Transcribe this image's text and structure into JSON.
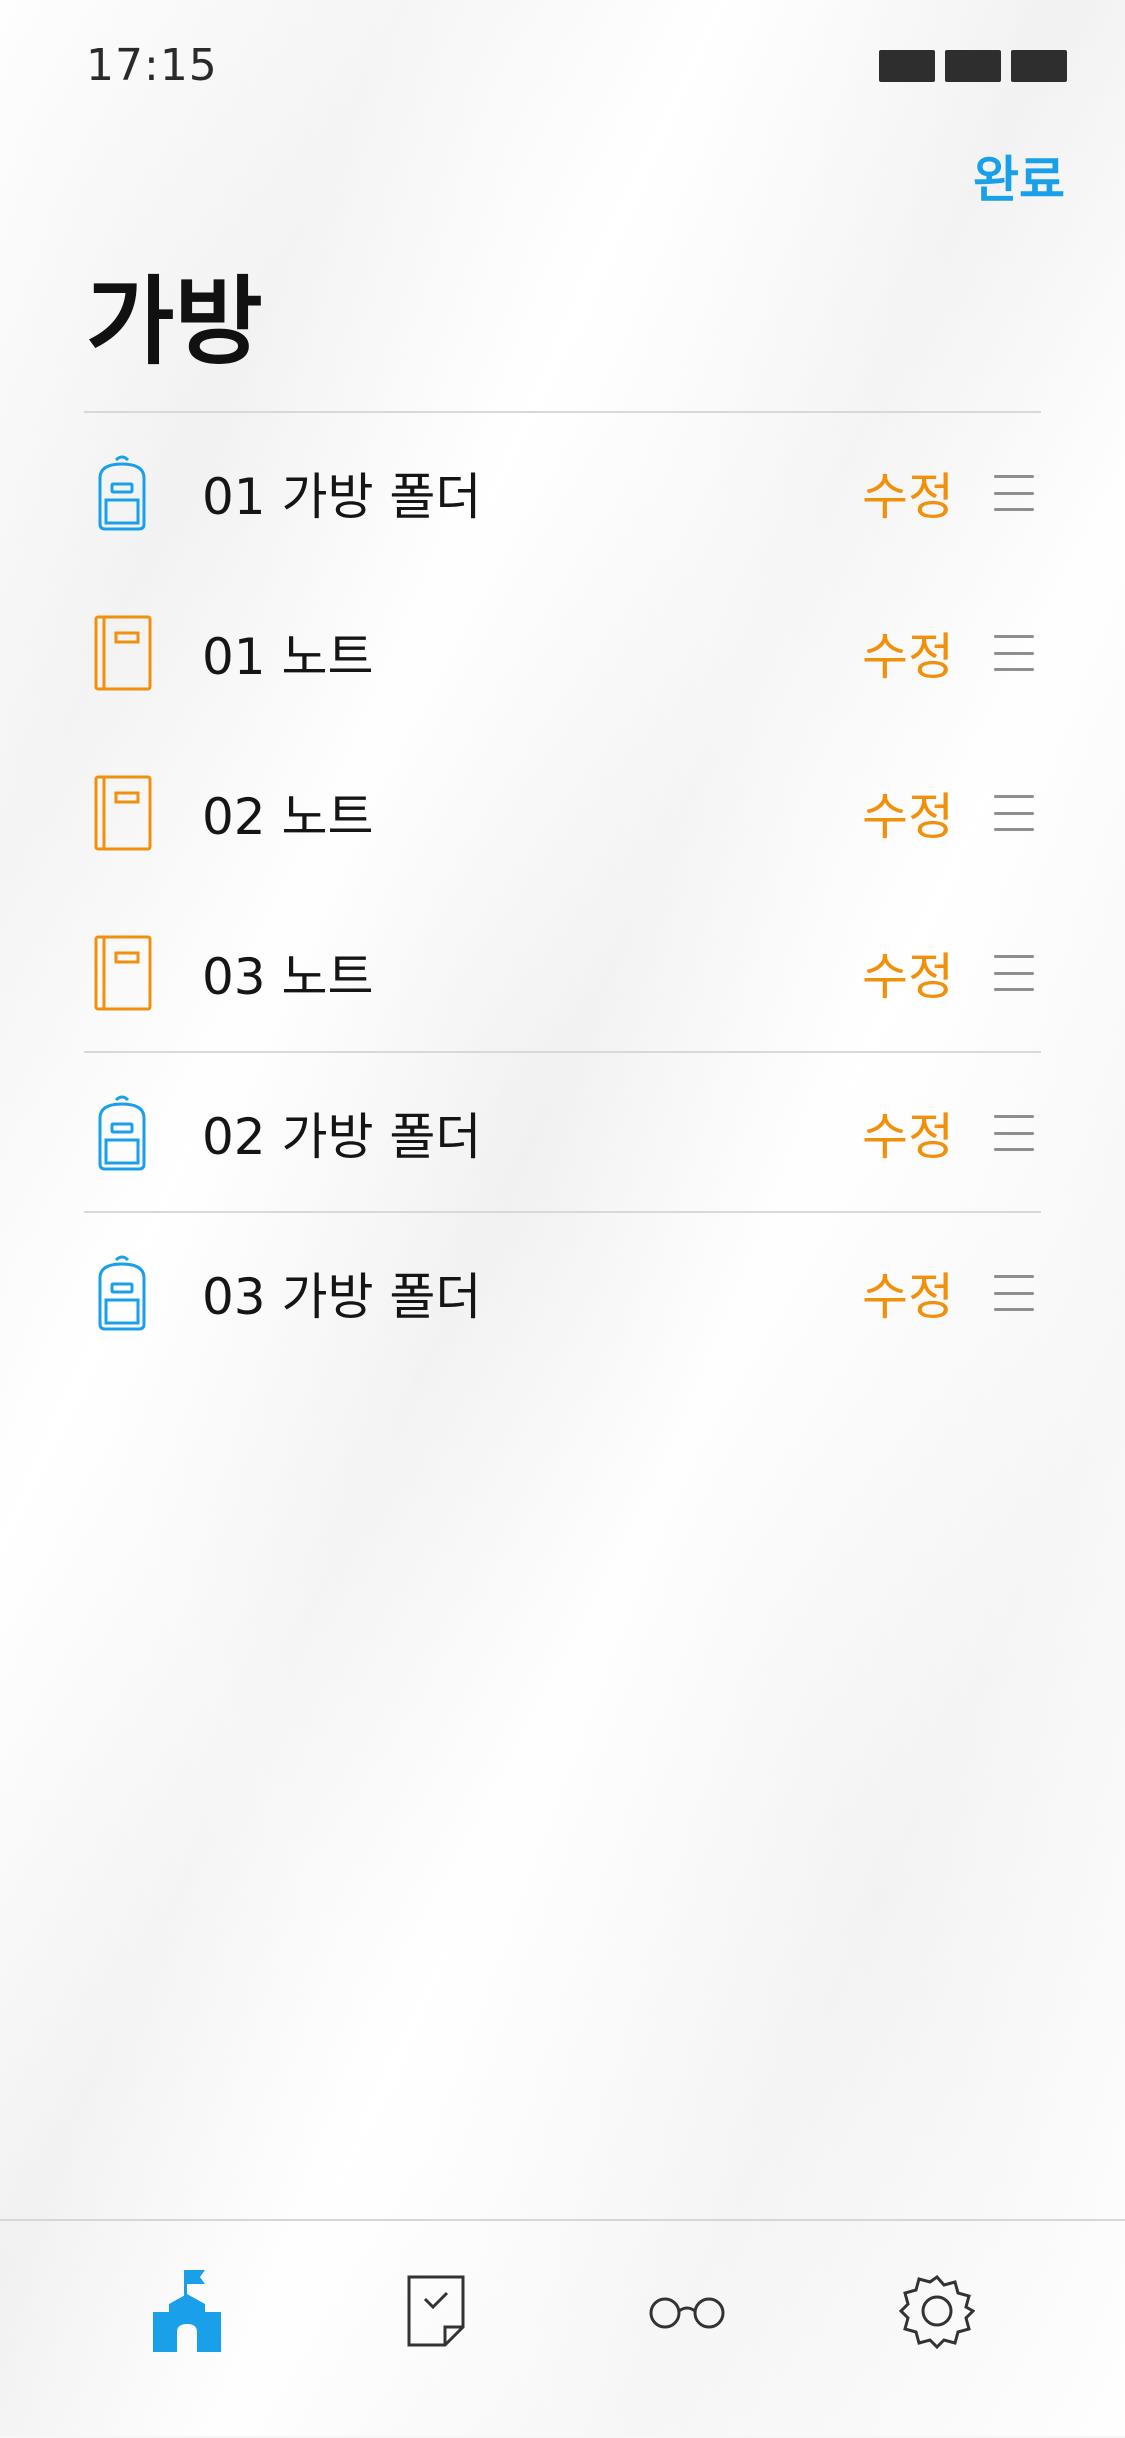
{
  "status_bar": {
    "time": "17:15"
  },
  "nav": {
    "done_label": "완료"
  },
  "page": {
    "title": "가방"
  },
  "items": [
    {
      "label": "01 가방 폴더",
      "type": "bag",
      "edit_label": "수정"
    },
    {
      "label": "01 노트",
      "type": "note",
      "edit_label": "수정"
    },
    {
      "label": "02 노트",
      "type": "note",
      "edit_label": "수정"
    },
    {
      "label": "03 노트",
      "type": "note",
      "edit_label": "수정"
    },
    {
      "label": "02 가방 폴더",
      "type": "bag",
      "edit_label": "수정"
    },
    {
      "label": "03 가방 폴더",
      "type": "bag",
      "edit_label": "수정"
    }
  ],
  "tabbar": {
    "tabs": [
      {
        "icon": "school-icon",
        "active": true
      },
      {
        "icon": "assignment-check-icon",
        "active": false
      },
      {
        "icon": "glasses-icon",
        "active": false
      },
      {
        "icon": "gear-icon",
        "active": false
      }
    ]
  },
  "colors": {
    "accent_blue": "#1aa0e8",
    "accent_orange": "#f0900c",
    "tab_inactive": "#333333"
  }
}
